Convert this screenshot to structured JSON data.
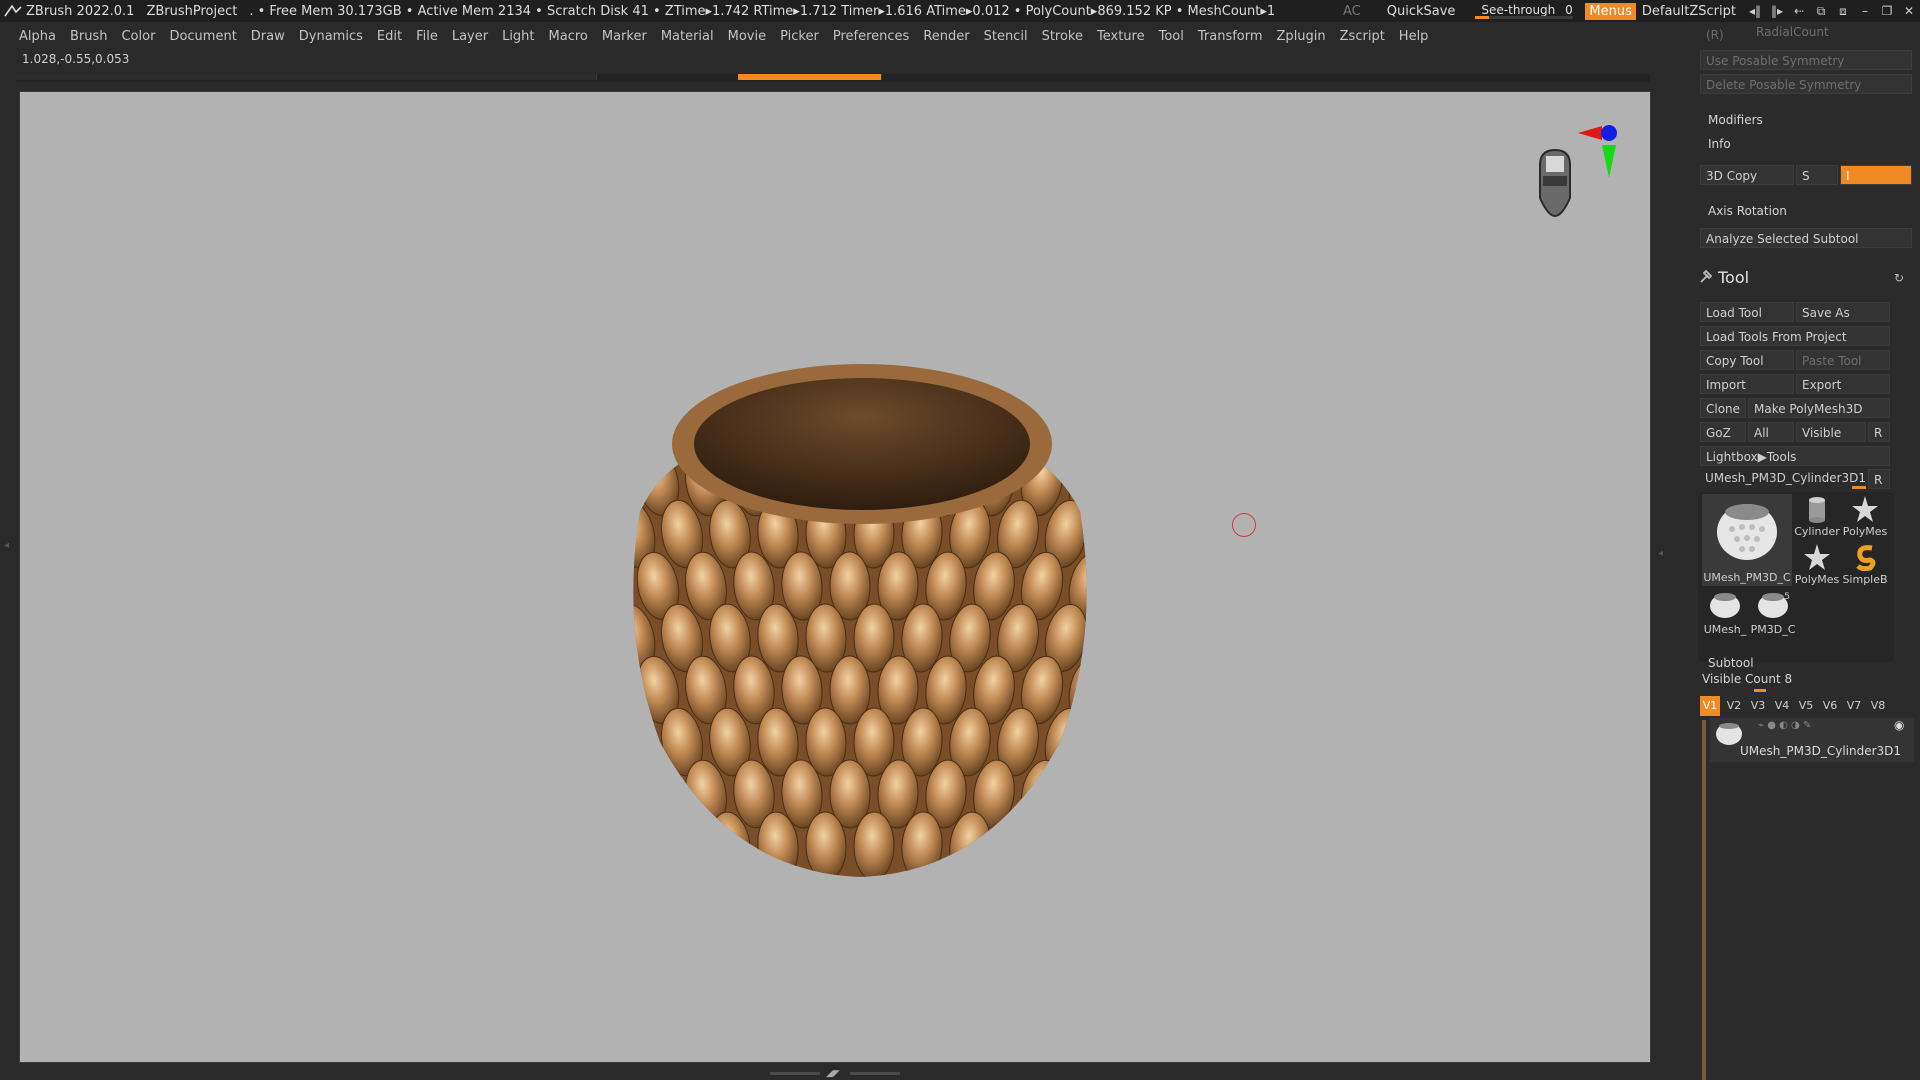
{
  "titlebar": {
    "app": "ZBrush 2022.0.1",
    "project": "ZBrushProject",
    "stats": ". • Free Mem 30.173GB • Active Mem 2134 • Scratch Disk 41 •  ZTime▸1.742 RTime▸1.712 Timer▸1.616 ATime▸0.012 • PolyCount▸869.152 KP  • MeshCount▸1",
    "ac": "AC",
    "quicksave": "QuickSave",
    "seethrough_label": "See-through",
    "seethrough_value": "0",
    "seethrough_level": 0.0,
    "menus": "Menus",
    "script": "DefaultZScript",
    "accent": "#f08a24"
  },
  "menubar": [
    "Alpha",
    "Brush",
    "Color",
    "Document",
    "Draw",
    "Dynamics",
    "Edit",
    "File",
    "Layer",
    "Light",
    "Macro",
    "Marker",
    "Material",
    "Movie",
    "Picker",
    "Preferences",
    "Render",
    "Stencil",
    "Stroke",
    "Texture",
    "Tool",
    "Transform",
    "Zplugin",
    "Zscript",
    "Help"
  ],
  "coords": "1.028,-0.55,0.053",
  "panel": {
    "r_label": "(R)",
    "radialcount": "RadialCount",
    "use_posable": "Use Posable Symmetry",
    "delete_posable": "Delete Posable Symmetry",
    "modifiers": "Modifiers",
    "info": "Info",
    "copy3d": "3D Copy",
    "s_label": "S",
    "i_label": "I",
    "axis_rotation": "Axis Rotation",
    "analyze": "Analyze Selected Subtool",
    "tool_title": "Tool",
    "load_tool": "Load Tool",
    "save_as": "Save As",
    "load_from_project": "Load Tools From Project",
    "copy_tool": "Copy Tool",
    "paste_tool": "Paste Tool",
    "import": "Import",
    "export": "Export",
    "clone": "Clone",
    "make_polymesh": "Make PolyMesh3D",
    "goz": "GoZ",
    "all": "All",
    "visible": "Visible",
    "r": "R",
    "lightbox": "Lightbox▶Tools",
    "current_tool": "UMesh_PM3D_Cylinder3D1.",
    "tiles": [
      {
        "label": "UMesh_PM3D_C",
        "icon": "umesh-thumb-icon"
      },
      {
        "label": "Cylinder",
        "icon": "cylinder-icon"
      },
      {
        "label": "PolyMes",
        "icon": "star-icon"
      },
      {
        "label": "PolyMes",
        "icon": "star-icon"
      },
      {
        "label": "SimpleB",
        "icon": "simplebrush-icon"
      },
      {
        "label": "UMesh_",
        "icon": "umesh-thumb-icon"
      },
      {
        "label": "PM3D_C",
        "icon": "umesh-thumb-icon"
      }
    ],
    "tile_badge": "5",
    "subtool": "Subtool",
    "visible_count": "Visible Count 8",
    "vtabs": [
      "V1",
      "V2",
      "V3",
      "V4",
      "V5",
      "V6",
      "V7",
      "V8"
    ],
    "subtool_item": "UMesh_PM3D_Cylinder3D1"
  }
}
